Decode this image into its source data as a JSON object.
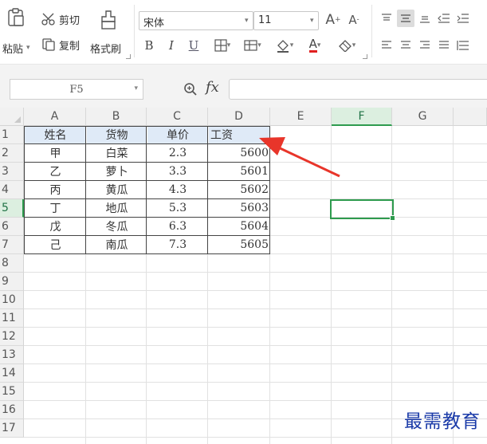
{
  "ribbon": {
    "paste_label": "粘贴",
    "cut_label": "剪切",
    "copy_label": "复制",
    "format_painter_label": "格式刷",
    "font_name": "宋体",
    "font_size": "11",
    "bold": "B",
    "italic": "I",
    "underline": "U",
    "grow_font": "A",
    "shrink_font": "A",
    "font_color_letter": "A",
    "font_color": "#e02020"
  },
  "formula_bar": {
    "name_box": "F5",
    "fx_label": "fx",
    "formula": ""
  },
  "columns": [
    "A",
    "B",
    "C",
    "D",
    "E",
    "F",
    "G"
  ],
  "active_column": "F",
  "rows": [
    "1",
    "2",
    "3",
    "4",
    "5",
    "6",
    "7",
    "8",
    "9",
    "10",
    "11",
    "12",
    "13",
    "14",
    "15",
    "16",
    "17"
  ],
  "active_row": "5",
  "selected_cell": "F5",
  "table": {
    "headers": [
      "姓名",
      "货物",
      "单价",
      "工资"
    ],
    "rows": [
      [
        "甲",
        "白菜",
        "2.3",
        "5600"
      ],
      [
        "乙",
        "萝卜",
        "3.3",
        "5601"
      ],
      [
        "丙",
        "黄瓜",
        "4.3",
        "5602"
      ],
      [
        "丁",
        "地瓜",
        "5.3",
        "5603"
      ],
      [
        "戊",
        "冬瓜",
        "6.3",
        "5604"
      ],
      [
        "己",
        "南瓜",
        "7.3",
        "5605"
      ]
    ]
  },
  "annotation_arrow_color": "#e8352a",
  "watermark": "最需教育",
  "colors": {
    "header_fill": "#dfeaf7",
    "selection": "#2e9b4e",
    "watermark": "#1a3aa8"
  }
}
